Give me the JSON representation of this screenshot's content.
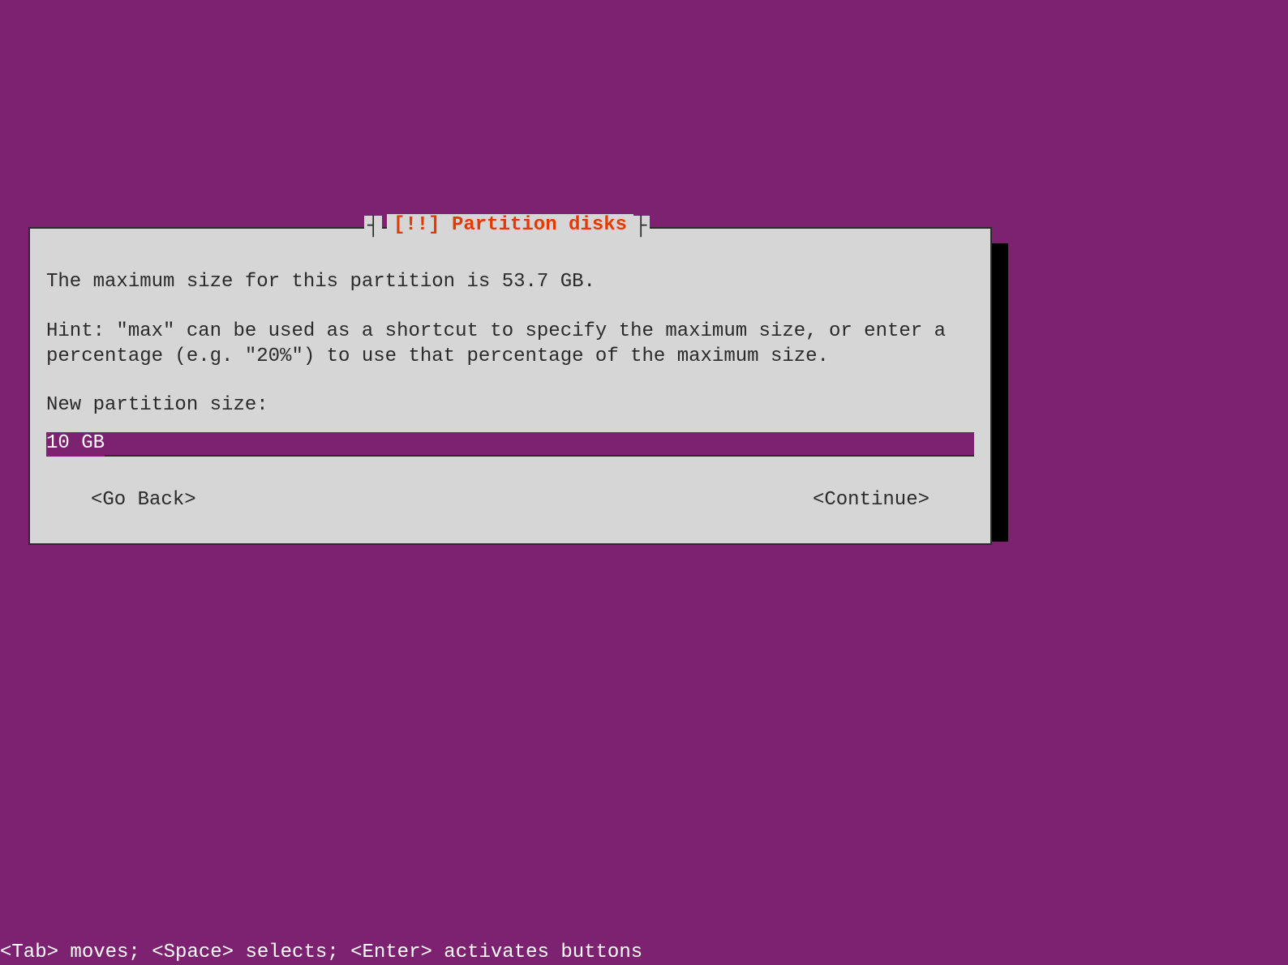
{
  "dialog": {
    "title": "[!!] Partition disks",
    "info_text": "The maximum size for this partition is 53.7 GB.",
    "hint_text": "Hint: \"max\" can be used as a shortcut to specify the maximum size, or enter a percentage (e.g. \"20%\") to use that percentage of the maximum size.",
    "prompt_label": "New partition size:",
    "input_value": "10 GB",
    "buttons": {
      "go_back": "<Go Back>",
      "continue": "<Continue>"
    }
  },
  "status_bar": "<Tab> moves; <Space> selects; <Enter> activates buttons"
}
